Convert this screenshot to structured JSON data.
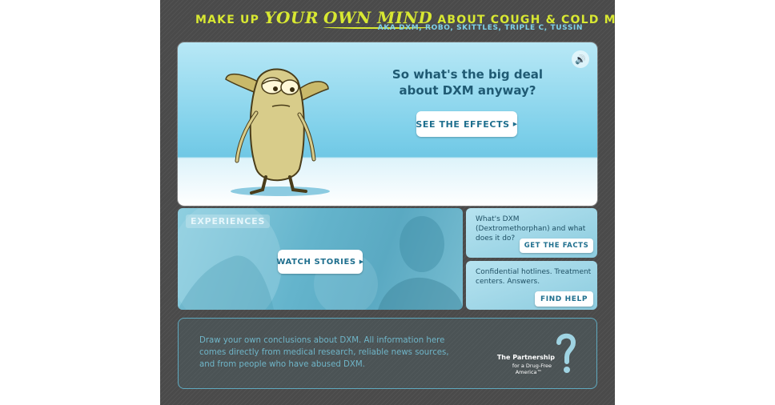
{
  "header": {
    "tagline_pre": "MAKE UP",
    "tagline_your": "YOUR",
    "tagline_own_mind": "OWN MIND",
    "tagline_post": "ABOUT COUGH & COLD MEDICINE",
    "aka": "AKA DXM, ROBO, SKITTLES, TRIPLE C, TUSSIN"
  },
  "hero": {
    "question": "So what's the big deal about DXM anyway?",
    "button_label": "SEE THE EFFECTS",
    "speaker_icon": "speaker-icon"
  },
  "experiences": {
    "label": "EXPERIENCES",
    "button_label": "WATCH STORIES"
  },
  "facts": {
    "text": "What's DXM (Dextromethorphan) and what does it do?",
    "button_label": "GET THE FACTS"
  },
  "help": {
    "text": "Confidential hotlines. Treatment centers. Answers.",
    "button_label": "FIND HELP"
  },
  "footer": {
    "text": "Draw your own conclusions about DXM. All information here comes directly from medical research, reliable news sources, and from people who have abused DXM.",
    "logo_line1": "The Partnership",
    "logo_line2": "for a Drug-Free",
    "logo_line3": "America™"
  },
  "colors": {
    "accent_yellow": "#d8e832",
    "accent_cyan": "#7fd0e8",
    "button_text": "#1f6f8e",
    "frame_bg": "#4a4a4a"
  }
}
